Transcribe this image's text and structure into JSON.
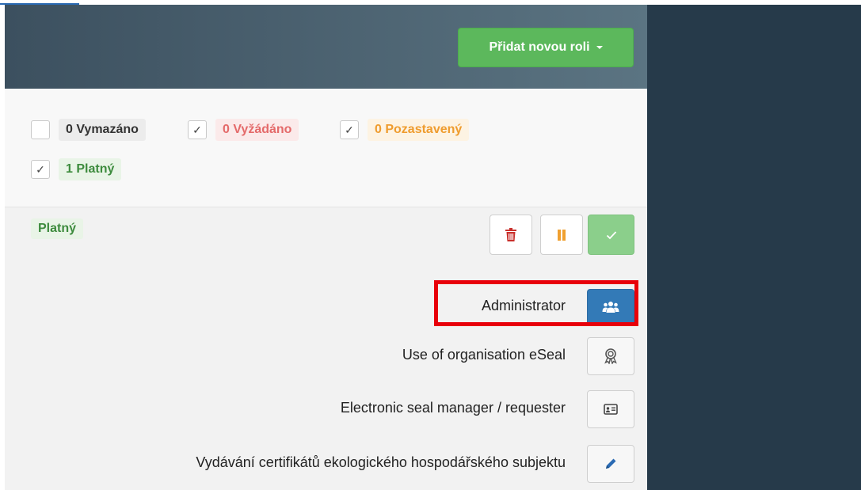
{
  "header": {
    "add_role_label": "Přidat novou roli"
  },
  "filters": [
    {
      "label": "0 Vymazáno",
      "checked": false,
      "color": "#333333"
    },
    {
      "label": "0 Vyžádáno",
      "checked": true,
      "color": "#e46a6a"
    },
    {
      "label": "0 Pozastavený",
      "checked": true,
      "color": "#ef9c2e"
    },
    {
      "label": "1 Platný",
      "checked": true,
      "color": "#3d8b3d"
    }
  ],
  "checkmark": "✓",
  "status": {
    "label": "Platný"
  },
  "actions": {
    "delete_icon": "trash-icon",
    "suspend_icon": "pause-icon",
    "approve_icon": "check-icon"
  },
  "roles": [
    {
      "label": "Administrator",
      "icon": "users-icon",
      "active": true
    },
    {
      "label": "Use of organisation eSeal",
      "icon": "seal-award-icon",
      "active": false
    },
    {
      "label": "Electronic seal manager / requester",
      "icon": "id-card-icon",
      "active": false
    },
    {
      "label": "Vydávání certifikátů ekologického hospodářského subjektu",
      "icon": "pencil-icon",
      "active": false
    }
  ],
  "colors": {
    "header_dark": "#3c505f",
    "right_panel": "#263a4a",
    "success": "#5cb85c",
    "primary": "#337ab7",
    "highlight": "#e8000a"
  }
}
